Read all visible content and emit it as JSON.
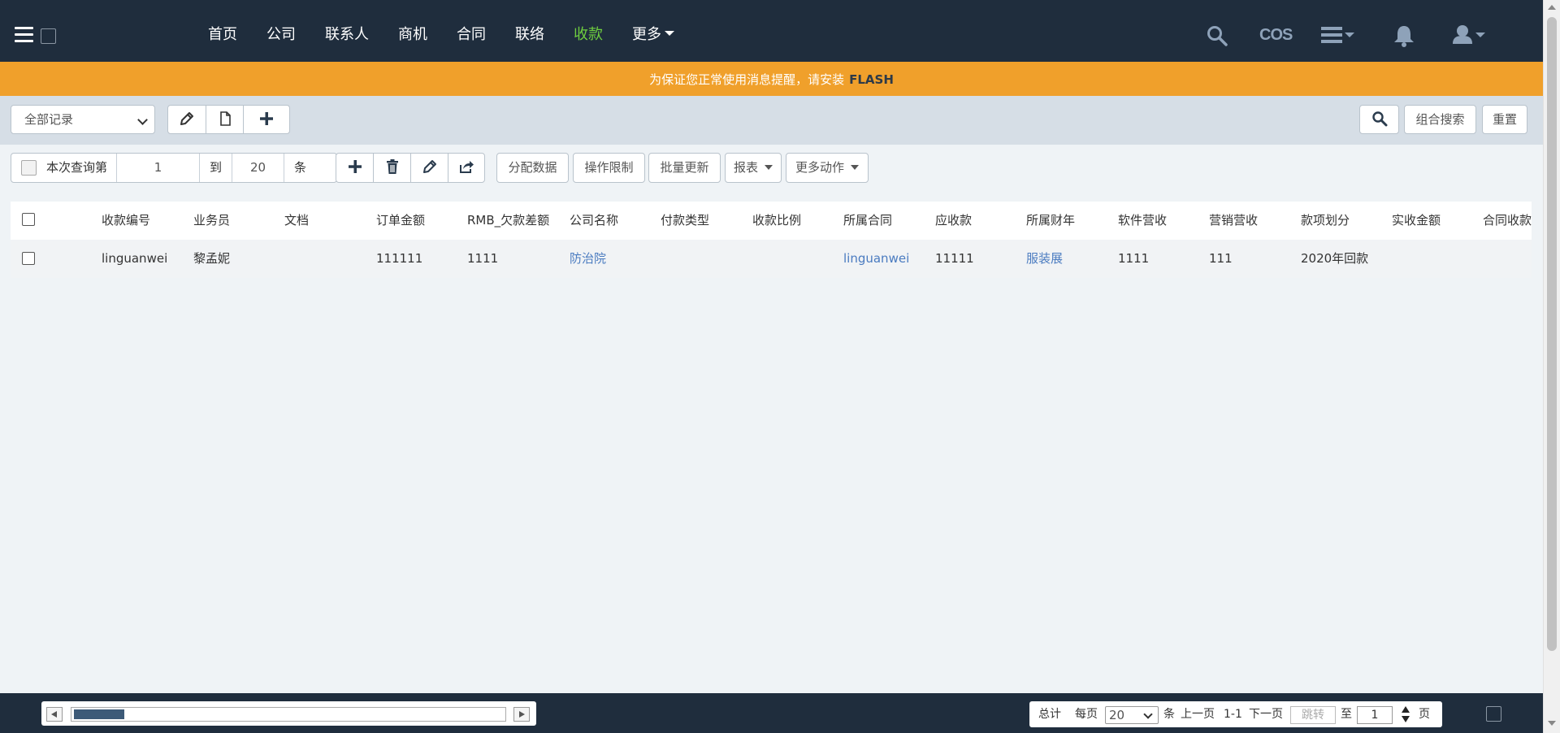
{
  "nav": {
    "items": [
      {
        "label": "首页"
      },
      {
        "label": "公司"
      },
      {
        "label": "联系人"
      },
      {
        "label": "商机"
      },
      {
        "label": "合同"
      },
      {
        "label": "联络"
      },
      {
        "label": "收款"
      },
      {
        "label": "更多"
      }
    ],
    "active_index": 6,
    "cos_label": "COS",
    "active_color": "#6fcf3f",
    "bar_color": "#1f2d3d"
  },
  "flash": {
    "message": "为保证您正常使用消息提醒，请安装",
    "keyword": "FLASH",
    "bar_color": "#f0a02b"
  },
  "toolbar": {
    "view_select": "全部记录",
    "combo_search_label": "组合搜索",
    "reset_label": "重置"
  },
  "query": {
    "prefix_label": "本次查询第",
    "from_value": "1",
    "to_label": "到",
    "to_value": "20",
    "unit_label": "条"
  },
  "actions": {
    "assign_label": "分配数据",
    "restrict_label": "操作限制",
    "batch_update_label": "批量更新",
    "report_label": "报表",
    "more_actions_label": "更多动作"
  },
  "table": {
    "columns": [
      "收款编号",
      "业务员",
      "文档",
      "订单金额",
      "RMB_欠款差额",
      "公司名称",
      "付款类型",
      "收款比例",
      "所属合同",
      "应收款",
      "所属财年",
      "软件营收",
      "营销营收",
      "款项划分",
      "实收金额",
      "合同收款"
    ],
    "rows": [
      [
        "linguanwei",
        "黎孟妮",
        "",
        "111111",
        "1111",
        "防治院",
        "",
        "",
        "linguanwei",
        "11111",
        "服装展",
        "1111",
        "111",
        "2020年回款",
        "",
        ""
      ]
    ],
    "link_color": "#4a7bc0"
  },
  "pager": {
    "total_label": "总计",
    "per_page_label": "每页",
    "per_page_value": "20",
    "unit_label": "条",
    "prev_label": "上一页",
    "range": "1-1",
    "next_label": "下一页",
    "jump_placeholder": "跳转",
    "to_label": "至",
    "page_value": "1",
    "page_label": "页"
  }
}
